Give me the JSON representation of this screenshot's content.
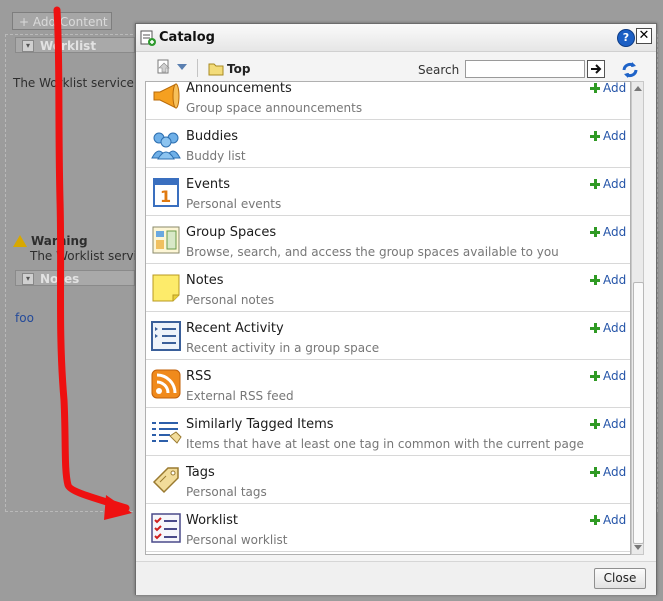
{
  "background": {
    "add_content_label": "+ Add Content",
    "worklist_header": "Worklist",
    "worklist_text": "The Worklist service is",
    "warning_title": "Warning",
    "warning_text": "The Worklist service",
    "notes_header": "Notes",
    "foo_link": "foo"
  },
  "dialog": {
    "title": "Catalog",
    "help_label": "?",
    "close_x_label": "✕",
    "breadcrumb": "Top",
    "search_label": "Search",
    "search_value": "",
    "close_button_label": "Close"
  },
  "catalog": {
    "add_label": "Add",
    "items": [
      {
        "title": "Announcements",
        "description": "Group space announcements",
        "icon": "megaphone-icon"
      },
      {
        "title": "Buddies",
        "description": "Buddy list",
        "icon": "people-icon"
      },
      {
        "title": "Events",
        "description": "Personal events",
        "icon": "calendar-icon"
      },
      {
        "title": "Group Spaces",
        "description": "Browse, search, and access the group spaces available to you",
        "icon": "group-spaces-icon"
      },
      {
        "title": "Notes",
        "description": "Personal notes",
        "icon": "note-icon"
      },
      {
        "title": "Recent Activity",
        "description": "Recent activity in a group space",
        "icon": "activity-list-icon"
      },
      {
        "title": "RSS",
        "description": "External RSS feed",
        "icon": "rss-icon"
      },
      {
        "title": "Similarly Tagged Items",
        "description": "Items that have at least one tag in common with the current page",
        "icon": "tagged-list-icon"
      },
      {
        "title": "Tags",
        "description": "Personal tags",
        "icon": "tag-icon"
      },
      {
        "title": "Worklist",
        "description": "Personal worklist",
        "icon": "checklist-icon"
      }
    ]
  },
  "colors": {
    "annotation_arrow": "#ee1111",
    "link": "#2454a8",
    "add_plus": "#2f9a24"
  }
}
